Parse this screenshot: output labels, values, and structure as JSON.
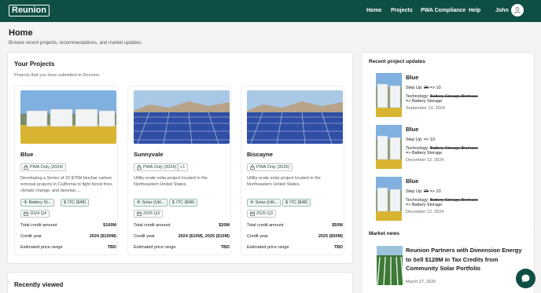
{
  "nav": {
    "logo": "Reunion",
    "links": [
      "Home",
      "Projects",
      "PWA Compliance",
      "Help"
    ],
    "user": "John",
    "user_icon": "user-icon"
  },
  "page": {
    "title": "Home",
    "subtitle": "Browse recent projects, recommendations, and market updates."
  },
  "your_projects": {
    "title": "Your Projects",
    "subtitle": "Projects that you have submitted to Reunion.",
    "labels": {
      "credit": "Total credit amount",
      "year": "Credit year",
      "price": "Estimated price range"
    },
    "cards": [
      {
        "name": "Blue",
        "pwa": "PWA Only (2024)",
        "desc": "Developing a Series of 10 $75M biochar carbon removal projects in California to fight forest fires, climate change, and develop ...",
        "tags": [
          "Battery St...",
          "ITC ($48)"
        ],
        "date": "2024 Q4",
        "credit": "$100M",
        "year": "2024 ($100M)",
        "price": "TBD"
      },
      {
        "name": "Sunnyvale",
        "pwa": "PWA Only (2024)",
        "extra": "+1",
        "desc": "Utility-scale solar project located in the Northeastern United States.",
        "tags": [
          "Solar (Util...",
          "ITC ($48)"
        ],
        "date": "2025 Q3",
        "credit": "$20M",
        "year": "2024 ($10M), 2025 ($10M)",
        "price": "TBD"
      },
      {
        "name": "Biscayne",
        "pwa": "PWA Only (2025)",
        "desc": "Utility-scale solar project located in the Northeastern United States.",
        "tags": [
          "Solar (Util...",
          "ITC ($48)"
        ],
        "date": "2025 Q3",
        "credit": "$50M",
        "year": "2025 ($50M)",
        "price": "TBD"
      }
    ]
  },
  "recently_viewed": {
    "title": "Recently viewed"
  },
  "updates": {
    "title": "Recent project updates",
    "items": [
      {
        "name": "Blue",
        "step_label": "Step Up:",
        "step_old": "20",
        "step_new": "=> 10",
        "tech_label": "Technology:",
        "tech_old": "Battery Storage,Biomass",
        "tech_new": "=> Battery Storage",
        "date": "September 13, 2024"
      },
      {
        "name": "Blue",
        "step_label": "Step Up:",
        "step_old": "",
        "step_new": "=> 10",
        "tech_label": "Technology:",
        "tech_old": "Battery Storage,Biomass",
        "tech_new": "=> Battery Storage",
        "date": "December 12, 2024"
      },
      {
        "name": "Blue",
        "step_label": "Step Up:",
        "step_old": "20",
        "step_new": "=> 10",
        "tech_label": "Technology:",
        "tech_old": "Battery Storage,Biomass",
        "tech_new": "=> Battery Storage",
        "date": "December 12, 2024"
      }
    ]
  },
  "market_news": {
    "title": "Market news",
    "headline": "Reunion Partners with Dimension Energy to Sell $128M in Tax Credits from Community Solar Portfolio",
    "date": "March 27, 2025"
  },
  "colors": {
    "brand": "#0f4e45",
    "accent": "#eef6f3"
  }
}
